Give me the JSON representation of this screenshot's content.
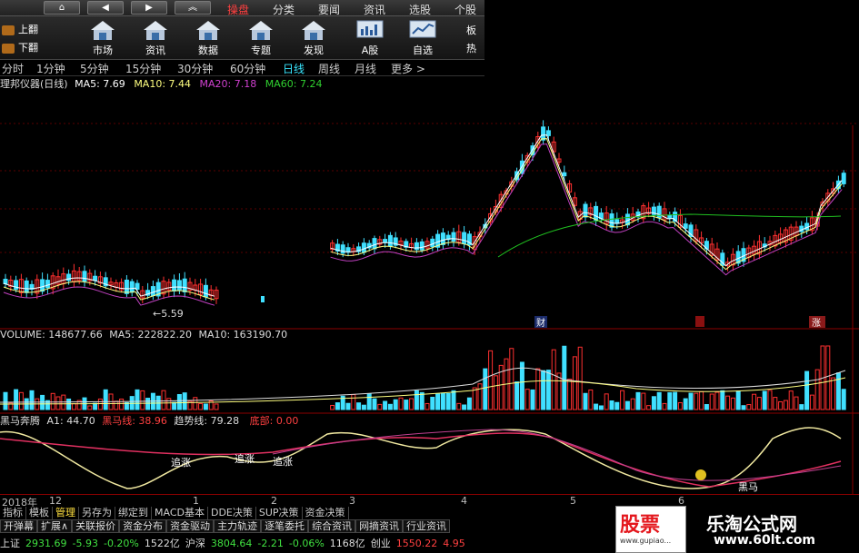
{
  "topbar": {
    "nav": [
      "⌂",
      "◀",
      "▶",
      "︽"
    ],
    "menu": [
      {
        "label": "操盘",
        "active": true
      },
      {
        "label": "分类",
        "active": false
      },
      {
        "label": "要闻",
        "active": false
      },
      {
        "label": "资讯",
        "active": false
      },
      {
        "label": "选股",
        "active": false
      },
      {
        "label": "个股",
        "active": false
      }
    ]
  },
  "toolbar": {
    "page_up": "上翻",
    "page_down": "下翻",
    "tools": [
      "市场",
      "资讯",
      "数据",
      "专题",
      "发现",
      "A股",
      "自选"
    ],
    "side": [
      "板",
      "热"
    ]
  },
  "periods": [
    "分时",
    "1分钟",
    "5分钟",
    "15分钟",
    "30分钟",
    "60分钟",
    "日线",
    "周线",
    "月线",
    "更多 >"
  ],
  "active_period": "日线",
  "ma_info": {
    "name": "理邦仪器(日线)",
    "ma5": "MA5: 7.69",
    "ma10": "MA10: 7.44",
    "ma20": "MA20: 7.18",
    "ma60": "MA60: 7.24"
  },
  "price_chart": {
    "low_marker": "←5.59",
    "markers": [
      "财",
      "涨"
    ],
    "colors": {
      "up": "#ff3030",
      "down": "#40e0ff",
      "ma5": "#ffffff",
      "ma10": "#ffff80",
      "ma20": "#c040c0",
      "ma60": "#20c020"
    }
  },
  "volume": {
    "label": "VOLUME: 148677.66",
    "ma5": "MA5: 222822.20",
    "ma10": "MA10: 163190.70"
  },
  "indicator": {
    "name": "黑马奔腾",
    "a1": "A1: 44.70",
    "hm": "黑马线: 38.96",
    "trend": "趋势线: 79.28",
    "bottom": "底部: 0.00",
    "labels": [
      "追涨",
      "追涨",
      "追涨",
      "黑马"
    ]
  },
  "date_axis": {
    "year": "2018年",
    "months": [
      "12",
      "1",
      "2",
      "3",
      "4",
      "5",
      "6"
    ]
  },
  "tabs1": [
    {
      "label": "指标",
      "active": false
    },
    {
      "label": "模板",
      "active": false
    },
    {
      "label": "管理",
      "active": true
    },
    {
      "label": "另存为",
      "active": false
    },
    {
      "label": "绑定到",
      "active": false
    },
    {
      "label": "MACD基本",
      "active": false
    },
    {
      "label": "DDE决策",
      "active": false
    },
    {
      "label": "SUP决策",
      "active": false
    },
    {
      "label": "资金决策",
      "active": false
    }
  ],
  "tabs2": [
    "开弹幕",
    "扩展∧",
    "关联报价",
    "资金分布",
    "资金驱动",
    "主力轨迹",
    "逐笔委托",
    "综合资讯",
    "网摘资讯",
    "行业资讯"
  ],
  "ticker": [
    {
      "text": "上证",
      "color": "#ddd"
    },
    {
      "text": "2931.69",
      "color": "#40e040"
    },
    {
      "text": "-5.93",
      "color": "#40e040"
    },
    {
      "text": "-0.20%",
      "color": "#40e040"
    },
    {
      "text": "1522亿",
      "color": "#ddd"
    },
    {
      "text": "沪深",
      "color": "#ddd"
    },
    {
      "text": "3804.64",
      "color": "#40e040"
    },
    {
      "text": "-2.21",
      "color": "#40e040"
    },
    {
      "text": "-0.06%",
      "color": "#40e040"
    },
    {
      "text": "1168亿",
      "color": "#ddd"
    },
    {
      "text": "创业",
      "color": "#ddd"
    },
    {
      "text": "1550.22",
      "color": "#ff4040"
    },
    {
      "text": "4.95",
      "color": "#ff4040"
    }
  ],
  "ad": {
    "logo": "股票",
    "logo_sub": "www.gupiao...",
    "title": "乐淘公式网",
    "url": "www.60lt.com"
  }
}
